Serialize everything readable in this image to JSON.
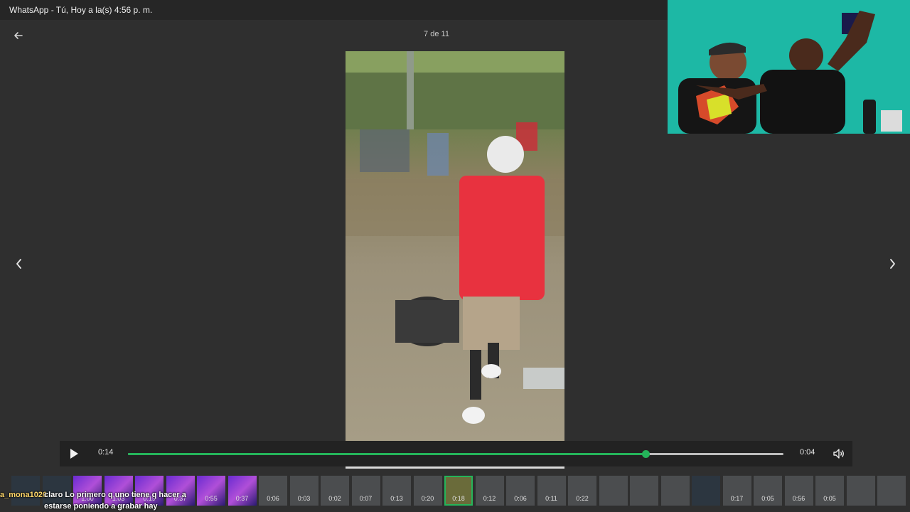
{
  "window": {
    "title": "WhatsApp - Tú, Hoy a la(s) 4:56 p. m."
  },
  "viewer": {
    "counter": "7 de 11"
  },
  "player": {
    "current_time": "0:14",
    "remaining_time": "0:04",
    "progress": 0.79,
    "accent_color": "#25b45a"
  },
  "icons": {
    "back": "arrow-left-icon",
    "prev": "chevron-left-icon",
    "next": "chevron-right-icon",
    "play": "play-icon",
    "volume": "volume-icon"
  },
  "thumbnails": [
    {
      "label": "",
      "style": "dark"
    },
    {
      "label": "",
      "style": "dark"
    },
    {
      "label": "1:00",
      "style": "neon"
    },
    {
      "label": "1:03",
      "style": "neon"
    },
    {
      "label": "0:19",
      "style": "neon"
    },
    {
      "label": "0:37",
      "style": "neon"
    },
    {
      "label": "0:55",
      "style": "neon"
    },
    {
      "label": "0:37",
      "style": "neon"
    },
    {
      "label": "0:06",
      "style": ""
    },
    {
      "label": "0:03",
      "style": ""
    },
    {
      "label": "0:02",
      "style": ""
    },
    {
      "label": "0:07",
      "style": ""
    },
    {
      "label": "0:13",
      "style": ""
    },
    {
      "label": "0:20",
      "style": ""
    },
    {
      "label": "0:18",
      "style": "active"
    },
    {
      "label": "0:12",
      "style": ""
    },
    {
      "label": "0:06",
      "style": ""
    },
    {
      "label": "0:11",
      "style": ""
    },
    {
      "label": "0:22",
      "style": ""
    },
    {
      "label": "",
      "style": ""
    },
    {
      "label": "",
      "style": ""
    },
    {
      "label": "",
      "style": ""
    },
    {
      "label": "",
      "style": "dark"
    },
    {
      "label": "0:17",
      "style": ""
    },
    {
      "label": "0:05",
      "style": ""
    },
    {
      "label": "0:56",
      "style": ""
    },
    {
      "label": "0:05",
      "style": ""
    },
    {
      "label": "",
      "style": ""
    },
    {
      "label": "",
      "style": ""
    }
  ],
  "chat_overlay": {
    "username": "a_mona1026",
    "message": "claro Lo primero q uno tiene q hacer a estarse poniendo a grabar hay"
  }
}
